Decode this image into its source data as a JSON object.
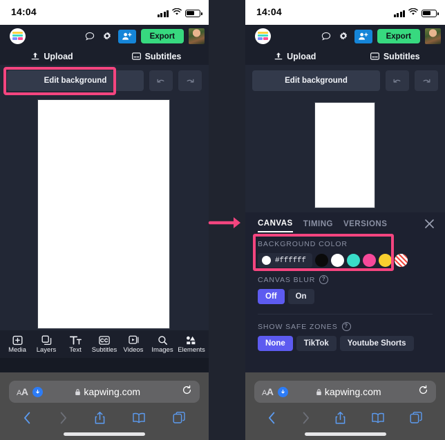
{
  "status_bar": {
    "time": "14:04"
  },
  "app_header": {
    "logo_name": "kapwing-logo",
    "comment_icon": "comment-icon",
    "settings_icon": "gear-icon",
    "invite_icon": "add-person-icon",
    "export_label": "Export",
    "avatar_name": "user-avatar"
  },
  "sub_toolbar": {
    "upload_label": "Upload",
    "subtitles_label": "Subtitles"
  },
  "edit_row": {
    "edit_background_label": "Edit background",
    "undo_label": "undo-icon",
    "redo_label": "redo-icon"
  },
  "tool_strip": {
    "items": [
      {
        "label": "Media",
        "icon": "media-plus-icon"
      },
      {
        "label": "Layers",
        "icon": "layers-icon"
      },
      {
        "label": "Text",
        "icon": "text-icon"
      },
      {
        "label": "Subtitles",
        "icon": "closed-caption-icon"
      },
      {
        "label": "Videos",
        "icon": "video-icon"
      },
      {
        "label": "Images",
        "icon": "search-icon"
      },
      {
        "label": "Elements",
        "icon": "elements-icon"
      }
    ]
  },
  "panel": {
    "tabs": [
      {
        "label": "CANVAS",
        "active": true
      },
      {
        "label": "TIMING",
        "active": false
      },
      {
        "label": "VERSIONS",
        "active": false
      }
    ],
    "close_icon": "close-icon",
    "background_color": {
      "label": "BACKGROUND COLOR",
      "current_hex": "#ffffff",
      "swatches": [
        {
          "name": "black",
          "color": "#0a0a0a"
        },
        {
          "name": "white",
          "color": "#ffffff"
        },
        {
          "name": "teal",
          "color": "#39dcc8"
        },
        {
          "name": "pink",
          "color": "#f6499a"
        },
        {
          "name": "yellow",
          "color": "#f9cf2e"
        },
        {
          "name": "transparent",
          "color": "transparent"
        }
      ]
    },
    "canvas_blur": {
      "label": "CANVAS BLUR",
      "help": "?",
      "options": [
        {
          "label": "Off",
          "selected": true
        },
        {
          "label": "On",
          "selected": false
        }
      ]
    },
    "safe_zones": {
      "label": "SHOW SAFE ZONES",
      "help": "?",
      "options": [
        {
          "label": "None",
          "selected": true
        },
        {
          "label": "TikTok",
          "selected": false
        },
        {
          "label": "Youtube Shorts",
          "selected": false
        }
      ]
    }
  },
  "browser": {
    "aa_label": "AA",
    "url": "kapwing.com",
    "lock_icon": "lock-icon",
    "reload_icon": "reload-icon",
    "back_icon": "chevron-left-icon",
    "forward_icon": "chevron-right-icon",
    "share_icon": "share-icon",
    "bookmarks_icon": "book-icon",
    "tabs_icon": "tabs-icon"
  },
  "annotation": {
    "highlight_color": "#f4457f",
    "arrow_name": "flow-arrow"
  }
}
